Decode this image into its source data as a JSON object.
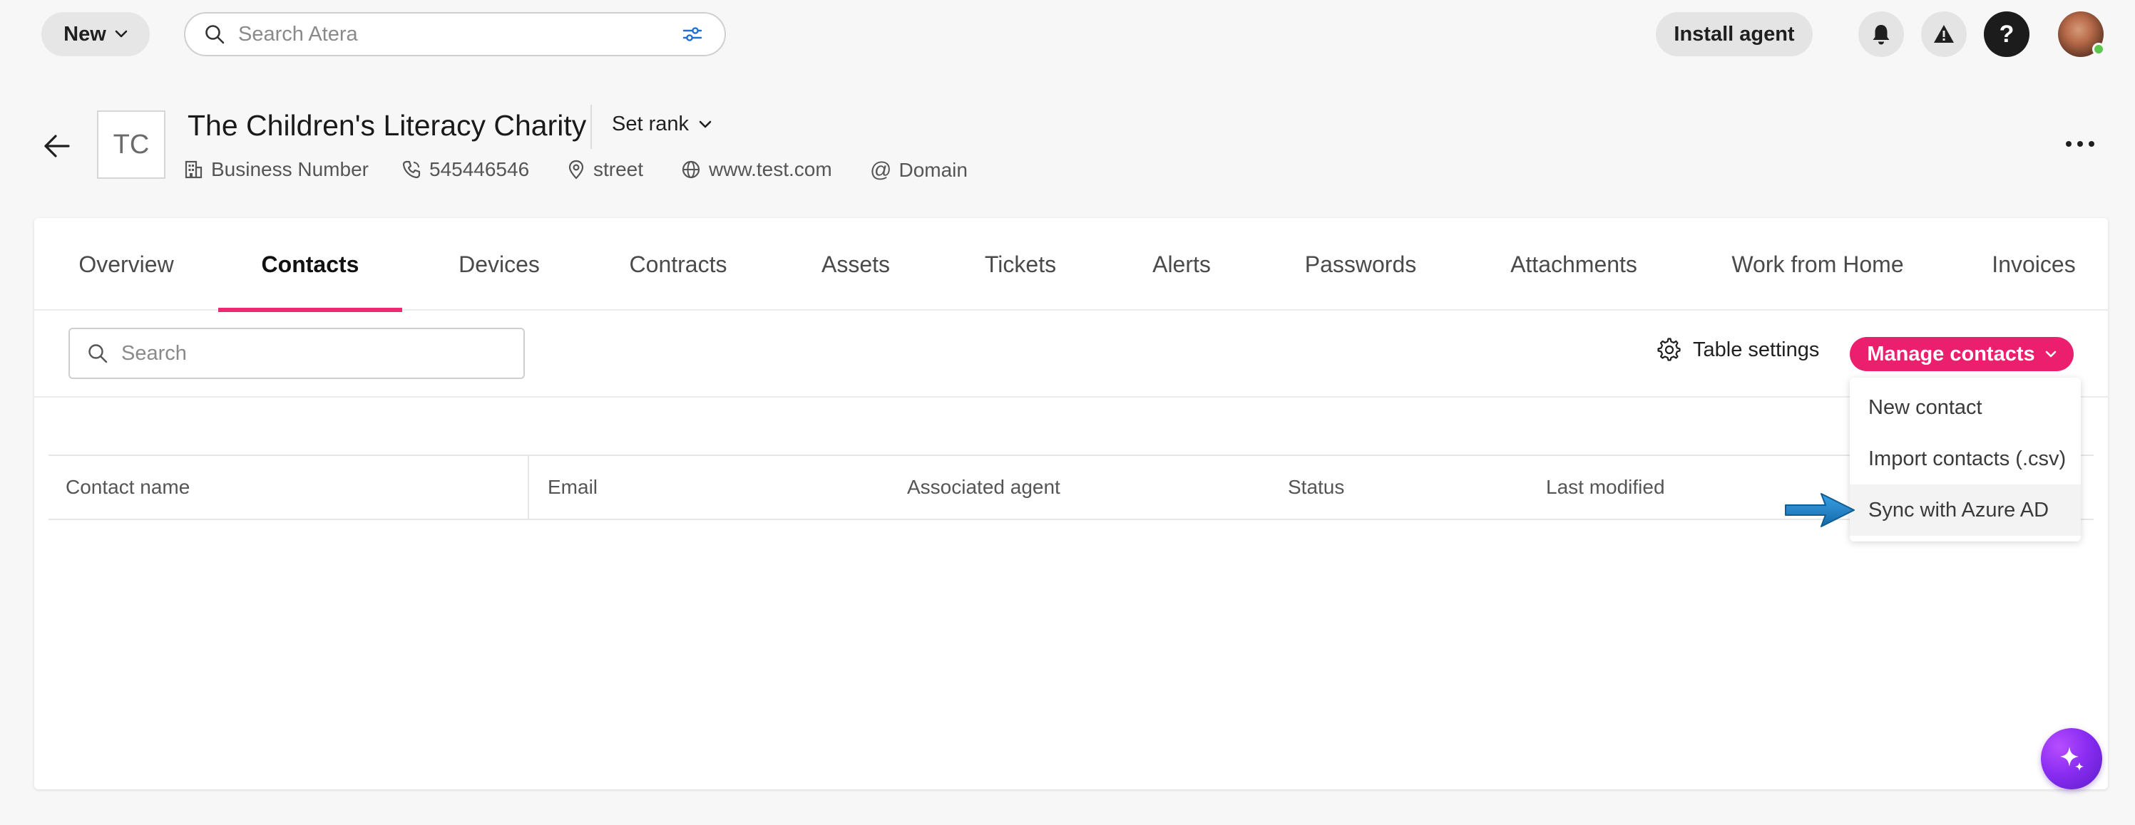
{
  "topbar": {
    "new_label": "New",
    "search_placeholder": "Search Atera",
    "install_label": "Install agent",
    "icons": [
      "bell-icon",
      "warning-icon",
      "help-icon",
      "avatar"
    ]
  },
  "customer": {
    "initials": "TC",
    "name": "The Children's Literacy Charity",
    "set_rank_label": "Set rank",
    "business_number": "Business Number",
    "phone": "545446546",
    "address": "street",
    "website": "www.test.com",
    "domain": "Domain"
  },
  "tabs": [
    {
      "label": "Overview"
    },
    {
      "label": "Contacts"
    },
    {
      "label": "Devices"
    },
    {
      "label": "Contracts"
    },
    {
      "label": "Assets"
    },
    {
      "label": "Tickets"
    },
    {
      "label": "Alerts"
    },
    {
      "label": "Passwords"
    },
    {
      "label": "Attachments"
    },
    {
      "label": "Work from Home"
    },
    {
      "label": "Invoices"
    }
  ],
  "active_tab": "Contacts",
  "contacts": {
    "search_placeholder": "Search",
    "table_settings_label": "Table settings",
    "manage_label": "Manage contacts",
    "columns": [
      "Contact name",
      "Email",
      "Associated agent",
      "Status",
      "Last modified"
    ]
  },
  "manage_menu": {
    "items": [
      "New contact",
      "Import contacts (.csv)",
      "Sync with Azure AD"
    ],
    "highlighted": "Sync with Azure AD"
  },
  "colors": {
    "accent": "#ec1e6e",
    "pointer_arrow": "#1f7fc4",
    "ai_button": "#8b2df2"
  }
}
